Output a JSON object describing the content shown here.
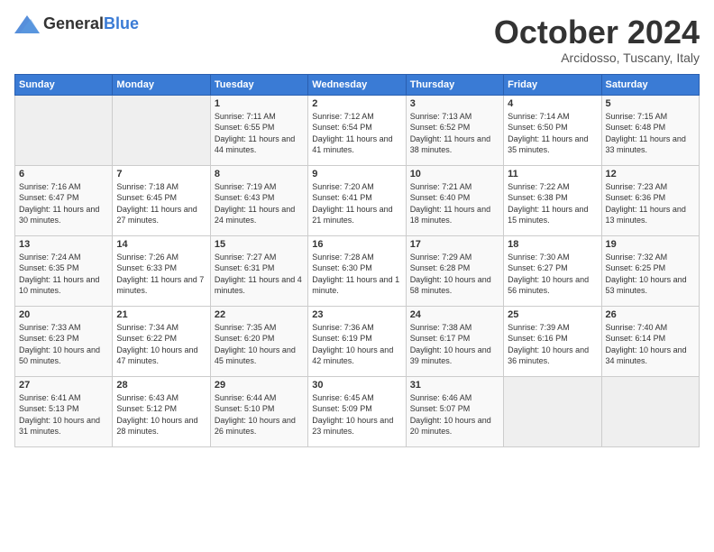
{
  "header": {
    "logo_general": "General",
    "logo_blue": "Blue",
    "month_title": "October 2024",
    "subtitle": "Arcidosso, Tuscany, Italy"
  },
  "columns": [
    "Sunday",
    "Monday",
    "Tuesday",
    "Wednesday",
    "Thursday",
    "Friday",
    "Saturday"
  ],
  "weeks": [
    [
      {
        "day": "",
        "info": ""
      },
      {
        "day": "",
        "info": ""
      },
      {
        "day": "1",
        "info": "Sunrise: 7:11 AM\nSunset: 6:55 PM\nDaylight: 11 hours and 44 minutes."
      },
      {
        "day": "2",
        "info": "Sunrise: 7:12 AM\nSunset: 6:54 PM\nDaylight: 11 hours and 41 minutes."
      },
      {
        "day": "3",
        "info": "Sunrise: 7:13 AM\nSunset: 6:52 PM\nDaylight: 11 hours and 38 minutes."
      },
      {
        "day": "4",
        "info": "Sunrise: 7:14 AM\nSunset: 6:50 PM\nDaylight: 11 hours and 35 minutes."
      },
      {
        "day": "5",
        "info": "Sunrise: 7:15 AM\nSunset: 6:48 PM\nDaylight: 11 hours and 33 minutes."
      }
    ],
    [
      {
        "day": "6",
        "info": "Sunrise: 7:16 AM\nSunset: 6:47 PM\nDaylight: 11 hours and 30 minutes."
      },
      {
        "day": "7",
        "info": "Sunrise: 7:18 AM\nSunset: 6:45 PM\nDaylight: 11 hours and 27 minutes."
      },
      {
        "day": "8",
        "info": "Sunrise: 7:19 AM\nSunset: 6:43 PM\nDaylight: 11 hours and 24 minutes."
      },
      {
        "day": "9",
        "info": "Sunrise: 7:20 AM\nSunset: 6:41 PM\nDaylight: 11 hours and 21 minutes."
      },
      {
        "day": "10",
        "info": "Sunrise: 7:21 AM\nSunset: 6:40 PM\nDaylight: 11 hours and 18 minutes."
      },
      {
        "day": "11",
        "info": "Sunrise: 7:22 AM\nSunset: 6:38 PM\nDaylight: 11 hours and 15 minutes."
      },
      {
        "day": "12",
        "info": "Sunrise: 7:23 AM\nSunset: 6:36 PM\nDaylight: 11 hours and 13 minutes."
      }
    ],
    [
      {
        "day": "13",
        "info": "Sunrise: 7:24 AM\nSunset: 6:35 PM\nDaylight: 11 hours and 10 minutes."
      },
      {
        "day": "14",
        "info": "Sunrise: 7:26 AM\nSunset: 6:33 PM\nDaylight: 11 hours and 7 minutes."
      },
      {
        "day": "15",
        "info": "Sunrise: 7:27 AM\nSunset: 6:31 PM\nDaylight: 11 hours and 4 minutes."
      },
      {
        "day": "16",
        "info": "Sunrise: 7:28 AM\nSunset: 6:30 PM\nDaylight: 11 hours and 1 minute."
      },
      {
        "day": "17",
        "info": "Sunrise: 7:29 AM\nSunset: 6:28 PM\nDaylight: 10 hours and 58 minutes."
      },
      {
        "day": "18",
        "info": "Sunrise: 7:30 AM\nSunset: 6:27 PM\nDaylight: 10 hours and 56 minutes."
      },
      {
        "day": "19",
        "info": "Sunrise: 7:32 AM\nSunset: 6:25 PM\nDaylight: 10 hours and 53 minutes."
      }
    ],
    [
      {
        "day": "20",
        "info": "Sunrise: 7:33 AM\nSunset: 6:23 PM\nDaylight: 10 hours and 50 minutes."
      },
      {
        "day": "21",
        "info": "Sunrise: 7:34 AM\nSunset: 6:22 PM\nDaylight: 10 hours and 47 minutes."
      },
      {
        "day": "22",
        "info": "Sunrise: 7:35 AM\nSunset: 6:20 PM\nDaylight: 10 hours and 45 minutes."
      },
      {
        "day": "23",
        "info": "Sunrise: 7:36 AM\nSunset: 6:19 PM\nDaylight: 10 hours and 42 minutes."
      },
      {
        "day": "24",
        "info": "Sunrise: 7:38 AM\nSunset: 6:17 PM\nDaylight: 10 hours and 39 minutes."
      },
      {
        "day": "25",
        "info": "Sunrise: 7:39 AM\nSunset: 6:16 PM\nDaylight: 10 hours and 36 minutes."
      },
      {
        "day": "26",
        "info": "Sunrise: 7:40 AM\nSunset: 6:14 PM\nDaylight: 10 hours and 34 minutes."
      }
    ],
    [
      {
        "day": "27",
        "info": "Sunrise: 6:41 AM\nSunset: 5:13 PM\nDaylight: 10 hours and 31 minutes."
      },
      {
        "day": "28",
        "info": "Sunrise: 6:43 AM\nSunset: 5:12 PM\nDaylight: 10 hours and 28 minutes."
      },
      {
        "day": "29",
        "info": "Sunrise: 6:44 AM\nSunset: 5:10 PM\nDaylight: 10 hours and 26 minutes."
      },
      {
        "day": "30",
        "info": "Sunrise: 6:45 AM\nSunset: 5:09 PM\nDaylight: 10 hours and 23 minutes."
      },
      {
        "day": "31",
        "info": "Sunrise: 6:46 AM\nSunset: 5:07 PM\nDaylight: 10 hours and 20 minutes."
      },
      {
        "day": "",
        "info": ""
      },
      {
        "day": "",
        "info": ""
      }
    ]
  ]
}
